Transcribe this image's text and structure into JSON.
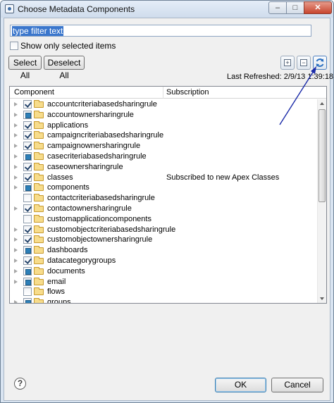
{
  "window": {
    "title": "Choose Metadata Components",
    "minimize_glyph": "–",
    "maximize_glyph": "□",
    "close_glyph": "✕"
  },
  "filter": {
    "value": "type filter text"
  },
  "show_only_selected": {
    "label": "Show only selected items",
    "checked": false
  },
  "buttons": {
    "select_all": "Select All",
    "deselect_all": "Deselect All",
    "expand_glyph": "+",
    "collapse_glyph": "−",
    "ok": "OK",
    "cancel": "Cancel",
    "help": "?"
  },
  "last_refreshed": "Last Refreshed: 2/9/13 1:39:18 PM",
  "table": {
    "headers": {
      "component": "Component",
      "subscription": "Subscription"
    },
    "rows": [
      {
        "name": "accountcriteriabasedsharingrule",
        "state": "checked",
        "expandable": true,
        "subscription": ""
      },
      {
        "name": "accountownersharingrule",
        "state": "partial",
        "expandable": true,
        "subscription": ""
      },
      {
        "name": "applications",
        "state": "checked",
        "expandable": true,
        "subscription": ""
      },
      {
        "name": "campaigncriteriabasedsharingrule",
        "state": "checked",
        "expandable": true,
        "subscription": ""
      },
      {
        "name": "campaignownersharingrule",
        "state": "checked",
        "expandable": true,
        "subscription": ""
      },
      {
        "name": "casecriteriabasedsharingrule",
        "state": "partial",
        "expandable": true,
        "subscription": ""
      },
      {
        "name": "caseownersharingrule",
        "state": "checked",
        "expandable": true,
        "subscription": ""
      },
      {
        "name": "classes",
        "state": "checked",
        "expandable": true,
        "subscription": "Subscribed to new Apex Classes"
      },
      {
        "name": "components",
        "state": "partial",
        "expandable": true,
        "subscription": ""
      },
      {
        "name": "contactcriteriabasedsharingrule",
        "state": "unchecked",
        "expandable": false,
        "subscription": ""
      },
      {
        "name": "contactownersharingrule",
        "state": "checked",
        "expandable": true,
        "subscription": ""
      },
      {
        "name": "customapplicationcomponents",
        "state": "unchecked",
        "expandable": false,
        "subscription": ""
      },
      {
        "name": "customobjectcriteriabasedsharingrule",
        "state": "checked",
        "expandable": true,
        "subscription": ""
      },
      {
        "name": "customobjectownersharingrule",
        "state": "checked",
        "expandable": true,
        "subscription": ""
      },
      {
        "name": "dashboards",
        "state": "partial",
        "expandable": true,
        "subscription": ""
      },
      {
        "name": "datacategorygroups",
        "state": "checked",
        "expandable": true,
        "subscription": ""
      },
      {
        "name": "documents",
        "state": "partial",
        "expandable": true,
        "subscription": ""
      },
      {
        "name": "email",
        "state": "partial",
        "expandable": true,
        "subscription": ""
      },
      {
        "name": "flows",
        "state": "unchecked",
        "expandable": false,
        "subscription": ""
      },
      {
        "name": "groups",
        "state": "partial",
        "expandable": true,
        "subscription": ""
      }
    ]
  },
  "colors": {
    "annotation_arrow": "#1a2aa8",
    "selection": "#3a76cc"
  }
}
